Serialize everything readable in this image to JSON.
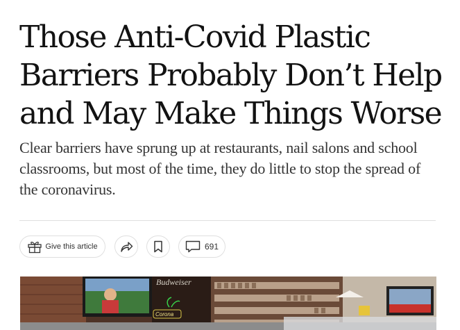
{
  "article": {
    "headline_lines": [
      "Those Anti-Covid Plastic",
      "Barriers Probably Don’t Help",
      "and May Make Things Worse"
    ],
    "summary": "Clear barriers have sprung up at restaurants, nail salons and school classrooms, but most of the time, they do little to stop the spread of the coronavirus."
  },
  "toolbar": {
    "gift_label": "Give this article",
    "comment_count": "691"
  },
  "icons": {
    "gift": "gift-icon",
    "share": "share-icon",
    "save": "bookmark-icon",
    "comments": "comment-icon"
  },
  "photo": {
    "signs": {
      "beer": "Budweiser",
      "bar": "Corona"
    }
  },
  "colors": {
    "text": "#121212",
    "summary": "#333333",
    "border": "#dfdfdf"
  }
}
